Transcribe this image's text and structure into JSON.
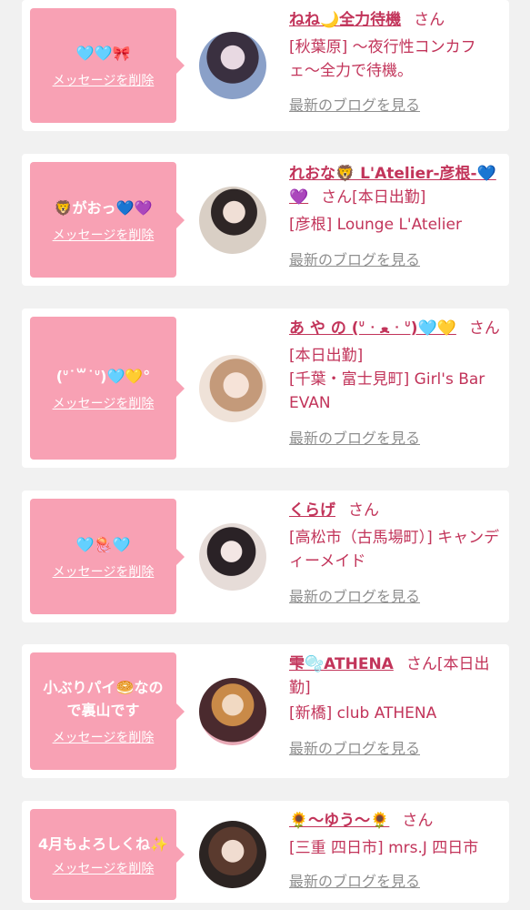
{
  "colors": {
    "bubble": "#f8a1b4",
    "accent": "#c2345a",
    "link_gray": "#8f8f8f",
    "background": "#f1f1f1"
  },
  "cast": [
    {
      "bubble_message": "🩵🩵🎀",
      "delete_label": "メッセージを削除",
      "name": "ねね🌙全力待機",
      "san": "さん",
      "details": [
        "[秋葉原] 〜夜行性コンカフェ〜全力で待機。"
      ],
      "blog_label": "最新のブログを見る"
    },
    {
      "bubble_message": "🦁がおっ💙💜",
      "delete_label": "メッセージを削除",
      "name": "れおな🦁 L'Atelier-彦根-💙💜",
      "san": "さん",
      "status": "[本日出勤]",
      "details": [
        "[彦根] Lounge L'Atelier"
      ],
      "blog_label": "最新のブログを見る"
    },
    {
      "bubble_message": "(ᐡ˙꒳˙ᐡ)🩵💛°",
      "delete_label": "メッセージを削除",
      "name": "あ や の (ᐡ ᐧ ﻌ ᐧ ᐡ)🩵💛",
      "san": "さん",
      "details": [
        "[本日出勤]",
        "[千葉・富士見町] Girl's Bar EVAN"
      ],
      "blog_label": "最新のブログを見る"
    },
    {
      "bubble_message": "🩵🪼🩵",
      "delete_label": "メッセージを削除",
      "name": "くらげ",
      "san": "さん",
      "details": [
        "[高松市（古馬場町）] キャンディーメイド"
      ],
      "blog_label": "最新のブログを見る"
    },
    {
      "bubble_message": "小ぶりパイ🥯なので裏山です",
      "delete_label": "メッセージを削除",
      "name": "雫🫧ATHENA",
      "san": "さん",
      "status": "[本日出勤]",
      "details": [
        "[新橋] club ATHENA"
      ],
      "blog_label": "最新のブログを見る"
    },
    {
      "bubble_message": "4月もよろしくね✨",
      "delete_label": "メッセージを削除",
      "name": "🌻〜ゆう〜🌻",
      "san": "さん",
      "details": [
        "[三重 四日市] mrs.J 四日市"
      ],
      "blog_label": "最新のブログを見る"
    }
  ]
}
